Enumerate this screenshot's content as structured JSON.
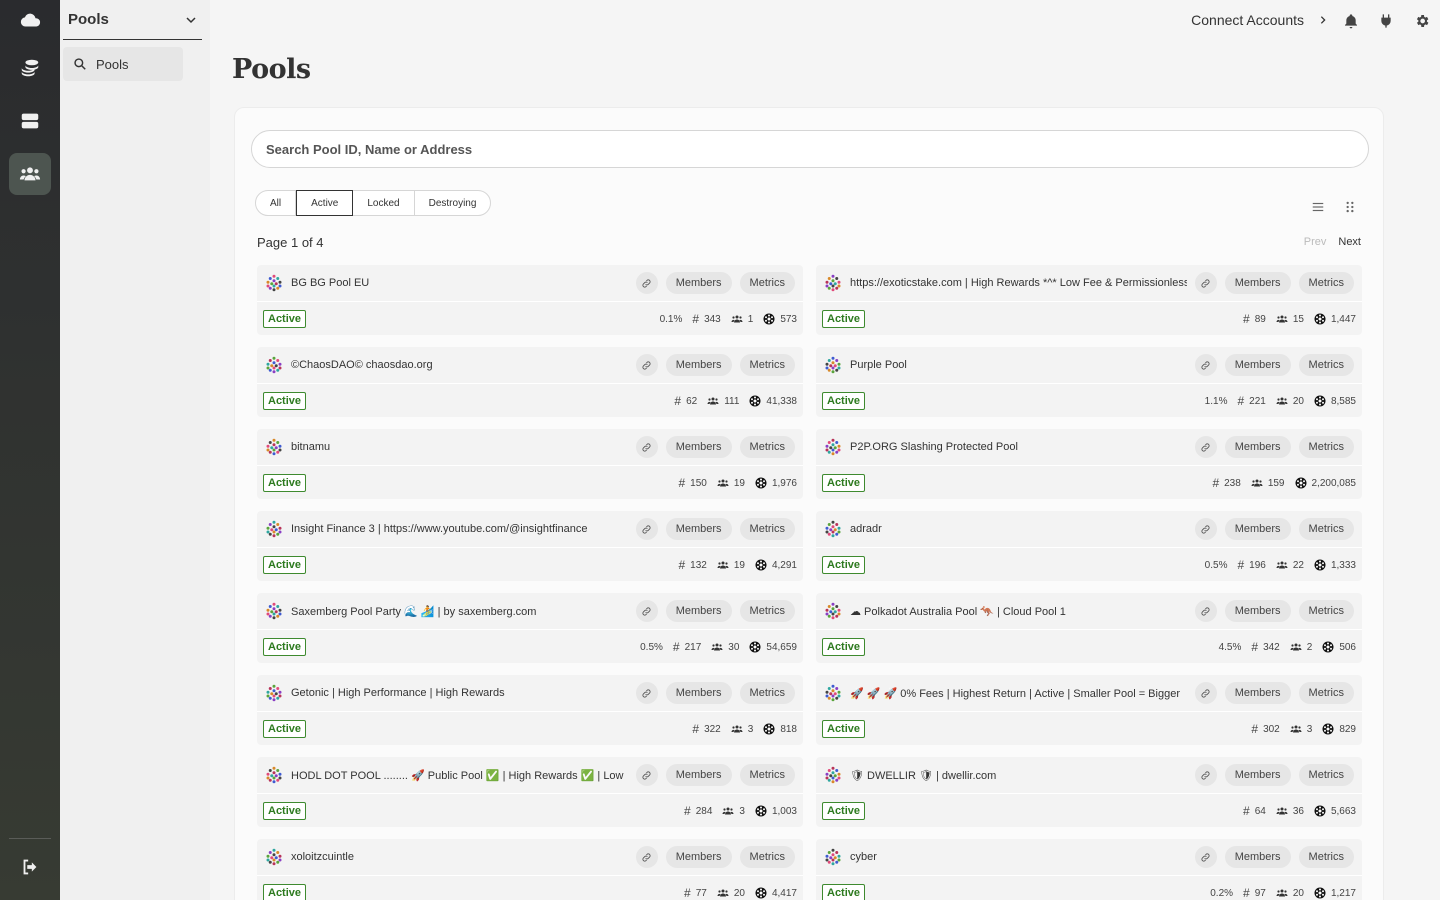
{
  "sidebar": {
    "select_label": "Pools",
    "item_label": "Pools"
  },
  "header": {
    "connect_label": "Connect Accounts"
  },
  "page": {
    "title": "Pools",
    "search_placeholder": "Search Pool ID, Name or Address",
    "tabs": [
      "All",
      "Active",
      "Locked",
      "Destroying"
    ],
    "active_tab": "Active",
    "page_info": "Page 1 of 4",
    "prev_label": "Prev",
    "next_label": "Next",
    "members_label": "Members",
    "metrics_label": "Metrics"
  },
  "pools": [
    {
      "name": "BG BG Pool EU",
      "status": "Active",
      "commission": "0.1%",
      "id": "343",
      "members": "1",
      "stake": "573"
    },
    {
      "name": "https://exoticstake.com | High Rewards *^* Low Fee & Permissionless",
      "status": "Active",
      "commission": "",
      "id": "89",
      "members": "15",
      "stake": "1,447"
    },
    {
      "name": "©ChaosDAO© chaosdao.org",
      "status": "Active",
      "commission": "",
      "id": "62",
      "members": "111",
      "stake": "41,338"
    },
    {
      "name": "Purple Pool",
      "status": "Active",
      "commission": "1.1%",
      "id": "221",
      "members": "20",
      "stake": "8,585"
    },
    {
      "name": "bitnamu",
      "status": "Active",
      "commission": "",
      "id": "150",
      "members": "19",
      "stake": "1,976"
    },
    {
      "name": "P2P.ORG Slashing Protected Pool",
      "status": "Active",
      "commission": "",
      "id": "238",
      "members": "159",
      "stake": "2,200,085"
    },
    {
      "name": "Insight Finance 3 | https://www.youtube.com/@insightfinance",
      "status": "Active",
      "commission": "",
      "id": "132",
      "members": "19",
      "stake": "4,291"
    },
    {
      "name": "adradr",
      "status": "Active",
      "commission": "0.5%",
      "id": "196",
      "members": "22",
      "stake": "1,333"
    },
    {
      "name": "Saxemberg Pool Party 🌊 🏄 | by saxemberg.com",
      "status": "Active",
      "commission": "0.5%",
      "id": "217",
      "members": "30",
      "stake": "54,659"
    },
    {
      "name": "☁ Polkadot Australia Pool 🦘 | Cloud Pool 1",
      "status": "Active",
      "commission": "4.5%",
      "id": "342",
      "members": "2",
      "stake": "506"
    },
    {
      "name": "Getonic | High Performance | High Rewards",
      "status": "Active",
      "commission": "",
      "id": "322",
      "members": "3",
      "stake": "818"
    },
    {
      "name": "🚀 🚀 🚀 0% Fees | Highest Return | Active | Smaller Pool = Bigger",
      "status": "Active",
      "commission": "",
      "id": "302",
      "members": "3",
      "stake": "829"
    },
    {
      "name": "HODL DOT POOL ........ 🚀 Public Pool ✅ | High Rewards ✅ | Low",
      "status": "Active",
      "commission": "",
      "id": "284",
      "members": "3",
      "stake": "1,003"
    },
    {
      "name": "🛡 DWELLIR 🛡 | dwellir.com",
      "status": "Active",
      "commission": "",
      "id": "64",
      "members": "36",
      "stake": "5,663"
    },
    {
      "name": "xoloitzcuintle",
      "status": "Active",
      "commission": "",
      "id": "77",
      "members": "20",
      "stake": "4,417"
    },
    {
      "name": "cyber",
      "status": "Active",
      "commission": "0.2%",
      "id": "97",
      "members": "20",
      "stake": "1,217"
    }
  ]
}
